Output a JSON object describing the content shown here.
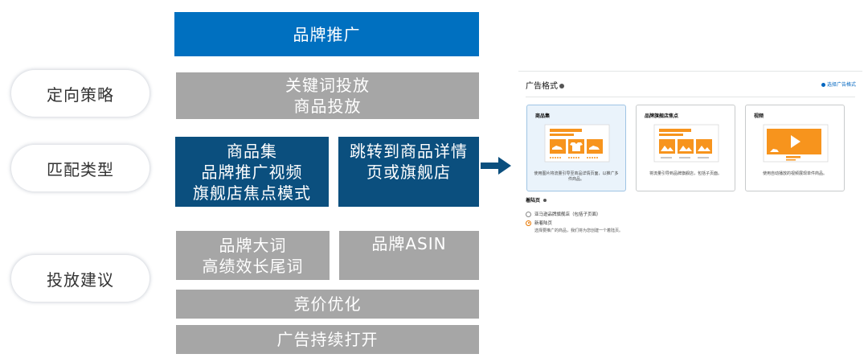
{
  "left": {
    "labels": {
      "targeting": "定向策略",
      "match_type": "匹配类型",
      "suggestion": "投放建议"
    },
    "brand_promo": "品牌推广",
    "targeting_box": {
      "line1": "关键词投放",
      "line2": "商品投放"
    },
    "match_left": {
      "line1": "商品集",
      "line2": "品牌推广视频",
      "line3": "旗舰店焦点模式"
    },
    "match_right": {
      "line1": "跳转到商品详情",
      "line2": "页或旗舰店"
    },
    "suggest_left": {
      "line1": "品牌大词",
      "line2": "高绩效长尾词"
    },
    "suggest_right": "品牌ASIN",
    "bid_optimize": "竞价优化",
    "ads_keep_on": "广告持续打开"
  },
  "panel": {
    "title": "广告格式",
    "choose_link": "选择广告格式",
    "cards": [
      {
        "title": "商品集",
        "desc": "使用图片将流量引导至商品详情页面，以推广多件商品。",
        "selected": true,
        "icon": "product-collection-icon"
      },
      {
        "title": "品牌旗舰店焦点",
        "desc": "将流量引导到品牌旗舰店，包括子页面。",
        "selected": false,
        "icon": "store-spotlight-icon"
      },
      {
        "title": "视频",
        "desc": "使用自动播放的视频展现单件商品。",
        "selected": false,
        "icon": "video-play-icon"
      }
    ],
    "landing_page": {
      "title": "着陆页",
      "options": [
        {
          "label": "亚马逊品牌旗舰店（包括子页面）",
          "selected": false
        },
        {
          "label": "新着陆页",
          "selected": true
        }
      ],
      "help": "选择要推广的商品，我们将为您创建一个着陆页。"
    },
    "colors": {
      "accent_orange": "#f7941d",
      "link_blue": "#0066c0"
    }
  }
}
